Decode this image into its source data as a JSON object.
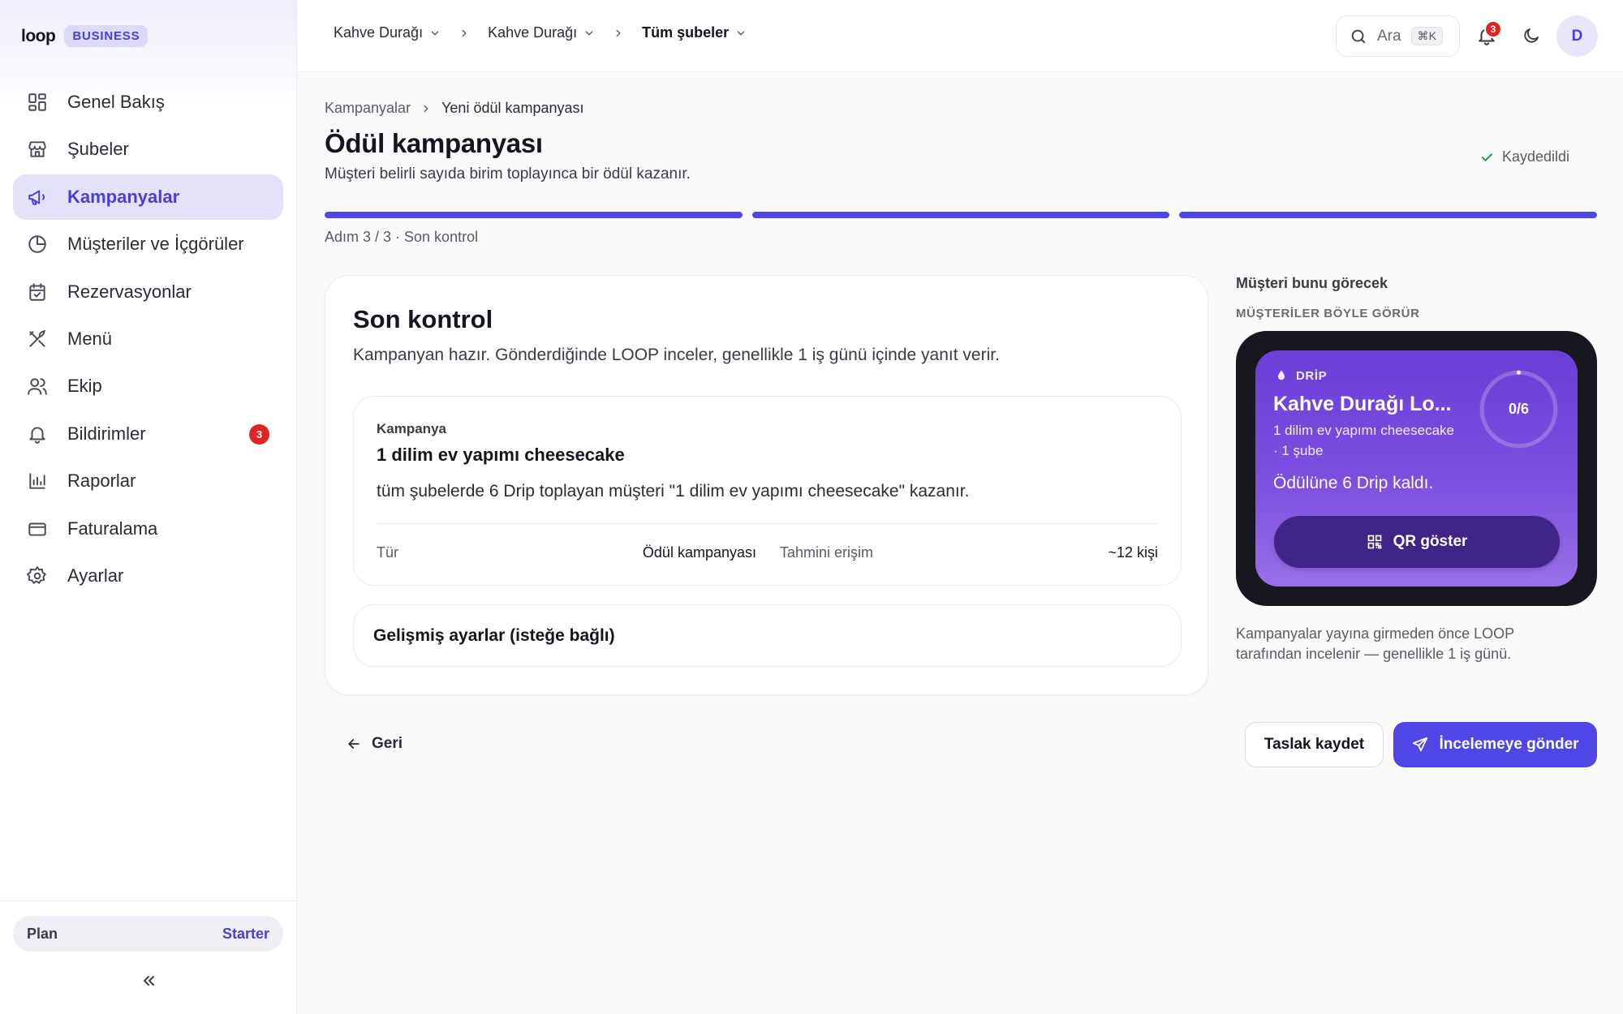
{
  "brand": {
    "logo": "loop",
    "badge": "BUSINESS"
  },
  "sidebar": {
    "items": [
      {
        "label": "Genel Bakış",
        "icon": "dashboard-icon"
      },
      {
        "label": "Şubeler",
        "icon": "store-icon"
      },
      {
        "label": "Kampanyalar",
        "icon": "megaphone-icon",
        "active": true
      },
      {
        "label": "Müşteriler ve İçgörüler",
        "icon": "pie-chart-icon"
      },
      {
        "label": "Rezervasyonlar",
        "icon": "calendar-check-icon"
      },
      {
        "label": "Menü",
        "icon": "utensils-icon"
      },
      {
        "label": "Ekip",
        "icon": "users-icon"
      },
      {
        "label": "Bildirimler",
        "icon": "bell-icon",
        "count": "3"
      },
      {
        "label": "Raporlar",
        "icon": "bar-chart-icon"
      },
      {
        "label": "Faturalama",
        "icon": "credit-card-icon"
      },
      {
        "label": "Ayarlar",
        "icon": "gear-icon"
      }
    ],
    "plan_label": "Plan",
    "plan_value": "Starter"
  },
  "topbar": {
    "breadcrumb": [
      "Kahve Durağı",
      "Kahve Durağı",
      "Tüm şubeler"
    ],
    "search_label": "Ara",
    "search_shortcut": "⌘K",
    "notification_count": "3",
    "avatar_initial": "D"
  },
  "main": {
    "breadcrumb_parent": "Kampanyalar",
    "breadcrumb_current": "Yeni ödül kampanyası",
    "title": "Ödül kampanyası",
    "subtitle": "Müşteri belirli sayıda birim toplayınca bir ödül kazanır.",
    "saved_label": "Kaydedildi",
    "progress_steps": [
      1,
      1,
      1
    ],
    "step_label": "Adım 3 / 3 · Son kontrol"
  },
  "review": {
    "title": "Son kontrol",
    "subtitle": "Kampanyan hazır. Gönderdiğinde LOOP inceler, genellikle 1 iş günü içinde yanıt verir.",
    "campaign_label": "Kampanya",
    "campaign_name": "1 dilim ev yapımı cheesecake",
    "campaign_desc": "tüm şubelerde 6 Drip toplayan müşteri \"1 dilim ev yapımı cheesecake\" kazanır.",
    "type_key": "Tür",
    "type_value": "Ödül kampanyası",
    "reach_key": "Tahmini erişim",
    "reach_value": "~12 kişi",
    "advanced_label": "Gelişmiş ayarlar (isteğe bağlı)"
  },
  "actions": {
    "back_label": "Geri",
    "draft_label": "Taslak kaydet",
    "submit_label": "İncelemeye gönder"
  },
  "preview": {
    "title": "Müşteri bunu görecek",
    "kicker": "MÜŞTERİLER BÖYLE GÖRÜR",
    "unit": "DRİP",
    "card_name": "Kahve Durağı Lo...",
    "reward_line": "1 dilim ev yapımı cheesecake · 1 şube",
    "progress_text": "0/6",
    "progress_fraction": 0,
    "remaining_text": "Ödülüne 6 Drip kaldı.",
    "qr_label": "QR göster",
    "note": "Kampanyalar yayına girmeden önce LOOP tarafından incelenir — genellikle 1 iş günü."
  },
  "colors": {
    "accent": "#4f46e5",
    "active_nav_bg": "#e4e2fb",
    "badge_red": "#e02424",
    "saved_green": "#16a34a",
    "preview_card": "#7c4fe0"
  }
}
